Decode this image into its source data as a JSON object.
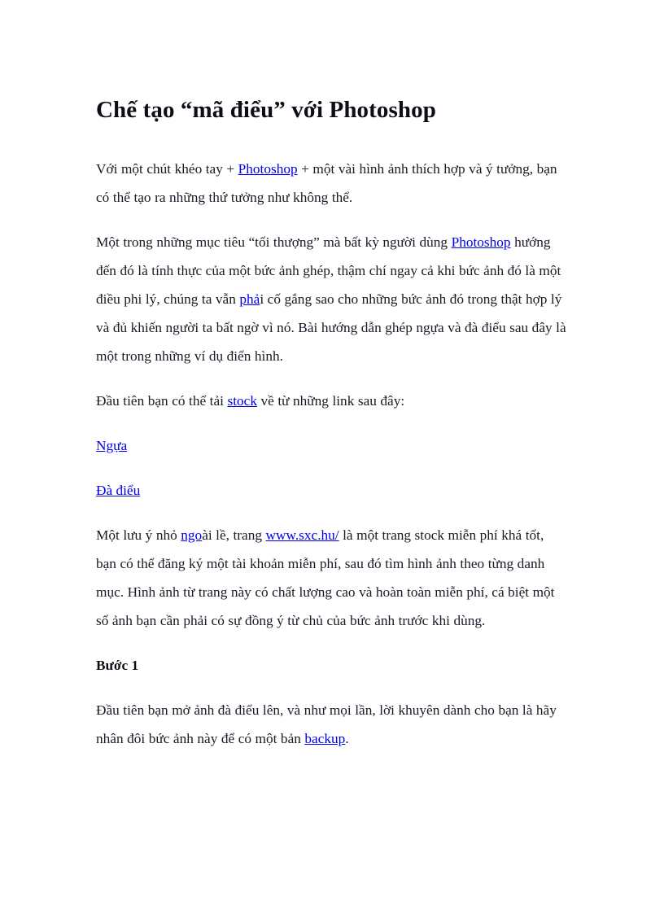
{
  "document": {
    "title": "Chế tạo “mã điểu” với Photoshop",
    "background_color": "#ffffff",
    "text_color": "#1a1a26",
    "link_color": "#0000ee"
  },
  "paragraphs": {
    "p1": {
      "before_link": "Với một chút khéo tay + ",
      "link": "Photoshop",
      "after_link": " + một vài hình ảnh thích hợp và ý tưởng, bạn có thể tạo ra những thứ tưởng như không thể."
    },
    "p2": {
      "before_link1": "Một trong những mục tiêu “tối thượng” mà bất kỳ người dùng ",
      "link1": "Photoshop",
      "between_links": " hướng đến đó là tính thực của một bức ảnh ghép, thậm chí ngay cả khi bức ảnh đó là một điều phi lý, chúng ta vẫn ",
      "link2": "phả",
      "after_link2": "i cố gắng sao cho những bức ảnh đó trong thật hợp lý và đủ khiến người ta bất ngờ vì nó. Bài hướng dẫn ghép ngựa và đà điểu sau đây là một trong những ví dụ điển hình."
    },
    "p3": {
      "before_link": "Đầu tiên bạn có thể tải ",
      "link": "stock",
      "after_link": " về từ những link sau đây:"
    },
    "link_horse": "Ngựa",
    "link_ostrich": "Đà điểu",
    "p4": {
      "before_link1": "Một lưu ý nhỏ ",
      "link1": "ngo",
      "between_links": "ài lề, trang ",
      "link2": "www.sxc.hu/",
      "after_link2": " là một trang stock miễn phí khá tốt, bạn có thể đăng ký một tài khoản miễn phí, sau đó tìm hình ảnh theo từng danh mục. Hình ảnh từ trang này có chất lượng cao và hoàn toàn miễn phí, cá biệt một số ảnh bạn cần phải có sự đồng ý từ chủ của bức ảnh trước khi dùng."
    },
    "step1_heading": "Bước 1",
    "p5": {
      "before_link": "Đầu tiên bạn mở ảnh đà điểu lên, và như mọi lần, lời khuyên dành cho bạn là hãy nhân đôi bức ảnh này để có một bản ",
      "link": "backup",
      "after_link": "."
    }
  }
}
